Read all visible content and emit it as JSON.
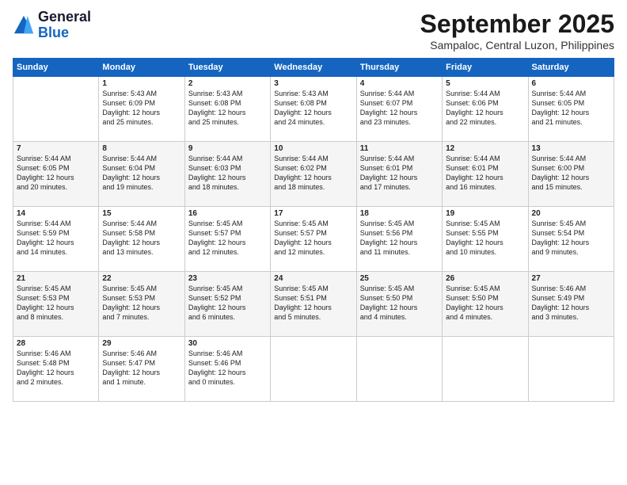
{
  "header": {
    "logo_line1": "General",
    "logo_line2": "Blue",
    "main_title": "September 2025",
    "subtitle": "Sampaloc, Central Luzon, Philippines"
  },
  "days_of_week": [
    "Sunday",
    "Monday",
    "Tuesday",
    "Wednesday",
    "Thursday",
    "Friday",
    "Saturday"
  ],
  "weeks": [
    [
      {
        "day": "",
        "content": ""
      },
      {
        "day": "1",
        "content": "Sunrise: 5:43 AM\nSunset: 6:09 PM\nDaylight: 12 hours\nand 25 minutes."
      },
      {
        "day": "2",
        "content": "Sunrise: 5:43 AM\nSunset: 6:08 PM\nDaylight: 12 hours\nand 25 minutes."
      },
      {
        "day": "3",
        "content": "Sunrise: 5:43 AM\nSunset: 6:08 PM\nDaylight: 12 hours\nand 24 minutes."
      },
      {
        "day": "4",
        "content": "Sunrise: 5:44 AM\nSunset: 6:07 PM\nDaylight: 12 hours\nand 23 minutes."
      },
      {
        "day": "5",
        "content": "Sunrise: 5:44 AM\nSunset: 6:06 PM\nDaylight: 12 hours\nand 22 minutes."
      },
      {
        "day": "6",
        "content": "Sunrise: 5:44 AM\nSunset: 6:05 PM\nDaylight: 12 hours\nand 21 minutes."
      }
    ],
    [
      {
        "day": "7",
        "content": "Sunrise: 5:44 AM\nSunset: 6:05 PM\nDaylight: 12 hours\nand 20 minutes."
      },
      {
        "day": "8",
        "content": "Sunrise: 5:44 AM\nSunset: 6:04 PM\nDaylight: 12 hours\nand 19 minutes."
      },
      {
        "day": "9",
        "content": "Sunrise: 5:44 AM\nSunset: 6:03 PM\nDaylight: 12 hours\nand 18 minutes."
      },
      {
        "day": "10",
        "content": "Sunrise: 5:44 AM\nSunset: 6:02 PM\nDaylight: 12 hours\nand 18 minutes."
      },
      {
        "day": "11",
        "content": "Sunrise: 5:44 AM\nSunset: 6:01 PM\nDaylight: 12 hours\nand 17 minutes."
      },
      {
        "day": "12",
        "content": "Sunrise: 5:44 AM\nSunset: 6:01 PM\nDaylight: 12 hours\nand 16 minutes."
      },
      {
        "day": "13",
        "content": "Sunrise: 5:44 AM\nSunset: 6:00 PM\nDaylight: 12 hours\nand 15 minutes."
      }
    ],
    [
      {
        "day": "14",
        "content": "Sunrise: 5:44 AM\nSunset: 5:59 PM\nDaylight: 12 hours\nand 14 minutes."
      },
      {
        "day": "15",
        "content": "Sunrise: 5:44 AM\nSunset: 5:58 PM\nDaylight: 12 hours\nand 13 minutes."
      },
      {
        "day": "16",
        "content": "Sunrise: 5:45 AM\nSunset: 5:57 PM\nDaylight: 12 hours\nand 12 minutes."
      },
      {
        "day": "17",
        "content": "Sunrise: 5:45 AM\nSunset: 5:57 PM\nDaylight: 12 hours\nand 12 minutes."
      },
      {
        "day": "18",
        "content": "Sunrise: 5:45 AM\nSunset: 5:56 PM\nDaylight: 12 hours\nand 11 minutes."
      },
      {
        "day": "19",
        "content": "Sunrise: 5:45 AM\nSunset: 5:55 PM\nDaylight: 12 hours\nand 10 minutes."
      },
      {
        "day": "20",
        "content": "Sunrise: 5:45 AM\nSunset: 5:54 PM\nDaylight: 12 hours\nand 9 minutes."
      }
    ],
    [
      {
        "day": "21",
        "content": "Sunrise: 5:45 AM\nSunset: 5:53 PM\nDaylight: 12 hours\nand 8 minutes."
      },
      {
        "day": "22",
        "content": "Sunrise: 5:45 AM\nSunset: 5:53 PM\nDaylight: 12 hours\nand 7 minutes."
      },
      {
        "day": "23",
        "content": "Sunrise: 5:45 AM\nSunset: 5:52 PM\nDaylight: 12 hours\nand 6 minutes."
      },
      {
        "day": "24",
        "content": "Sunrise: 5:45 AM\nSunset: 5:51 PM\nDaylight: 12 hours\nand 5 minutes."
      },
      {
        "day": "25",
        "content": "Sunrise: 5:45 AM\nSunset: 5:50 PM\nDaylight: 12 hours\nand 4 minutes."
      },
      {
        "day": "26",
        "content": "Sunrise: 5:45 AM\nSunset: 5:50 PM\nDaylight: 12 hours\nand 4 minutes."
      },
      {
        "day": "27",
        "content": "Sunrise: 5:46 AM\nSunset: 5:49 PM\nDaylight: 12 hours\nand 3 minutes."
      }
    ],
    [
      {
        "day": "28",
        "content": "Sunrise: 5:46 AM\nSunset: 5:48 PM\nDaylight: 12 hours\nand 2 minutes."
      },
      {
        "day": "29",
        "content": "Sunrise: 5:46 AM\nSunset: 5:47 PM\nDaylight: 12 hours\nand 1 minute."
      },
      {
        "day": "30",
        "content": "Sunrise: 5:46 AM\nSunset: 5:46 PM\nDaylight: 12 hours\nand 0 minutes."
      },
      {
        "day": "",
        "content": ""
      },
      {
        "day": "",
        "content": ""
      },
      {
        "day": "",
        "content": ""
      },
      {
        "day": "",
        "content": ""
      }
    ]
  ]
}
